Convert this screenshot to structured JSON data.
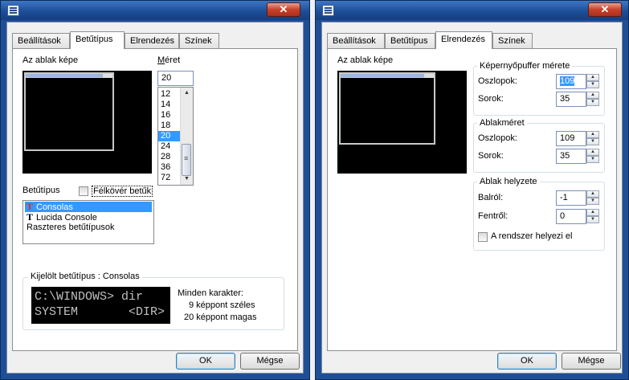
{
  "window1": {
    "close_label": "✕",
    "tabs": [
      "Beállítások",
      "Betűtípus",
      "Elrendezés",
      "Színek"
    ],
    "active_tab": "Betűtípus",
    "window_preview_label": "Az ablak képe",
    "size_label": "Méret",
    "size_value": "20",
    "size_list": [
      "12",
      "14",
      "16",
      "18",
      "20",
      "24",
      "28",
      "36",
      "72"
    ],
    "size_selected": "20",
    "font_label": "Betűtípus",
    "bold_label": "Félkövér betűk",
    "fonts": [
      "Consolas",
      "Lucida Console",
      "Raszteres betűtípusok"
    ],
    "font_selected": "Consolas",
    "selected_font_title": "Kijelölt betűtípus : Consolas",
    "sample_line1": "C:\\WINDOWS> dir",
    "sample_line2": "SYSTEM       <DIR>",
    "char_info_title": "Minden karakter:",
    "char_width": "9 képpont széles",
    "char_height": "20 képpont magas",
    "ok_label": "OK",
    "cancel_label": "Mégse"
  },
  "window2": {
    "close_label": "✕",
    "tabs": [
      "Beállítások",
      "Betűtípus",
      "Elrendezés",
      "Színek"
    ],
    "active_tab": "Elrendezés",
    "window_preview_label": "Az ablak képe",
    "buffer_group": "Képernyőpuffer mérete",
    "buffer_columns_label": "Oszlopok:",
    "buffer_columns_value": "109",
    "buffer_rows_label": "Sorok:",
    "buffer_rows_value": "35",
    "size_group": "Ablakméret",
    "size_columns_label": "Oszlopok:",
    "size_columns_value": "109",
    "size_rows_label": "Sorok:",
    "size_rows_value": "35",
    "position_group": "Ablak helyzete",
    "left_label": "Balról:",
    "left_value": "-1",
    "top_label": "Fentről:",
    "top_value": "0",
    "system_position_label": "A rendszer helyezi el",
    "ok_label": "OK",
    "cancel_label": "Mégse"
  }
}
